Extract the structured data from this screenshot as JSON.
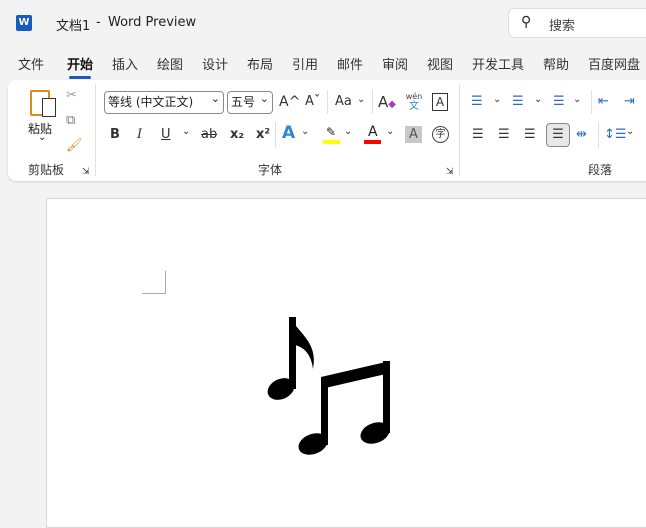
{
  "title": {
    "doc": "文档1",
    "sep": "-",
    "app": "Word Preview",
    "search_placeholder": "搜索"
  },
  "tabs": [
    "文件",
    "开始",
    "插入",
    "绘图",
    "设计",
    "布局",
    "引用",
    "邮件",
    "审阅",
    "视图",
    "开发工具",
    "帮助",
    "百度网盘"
  ],
  "active_tab": 1,
  "clipboard": {
    "paste": "粘贴",
    "group": "剪贴板"
  },
  "font": {
    "name": "等线 (中文正文)",
    "size": "五号",
    "group": "字体",
    "bold": "B",
    "italic": "I",
    "underline": "U",
    "strike": "ab",
    "sub": "x₂",
    "sup": "x²",
    "grow": "A^",
    "shrink": "Aˇ",
    "case": "Aa",
    "phonetic_top": "wén",
    "phonetic": "文",
    "border_char": "A",
    "shade_char": "A",
    "enclose": "字",
    "highlight_color": "#ffff00",
    "font_color": "#ff0000"
  },
  "paragraph": {
    "group": "段落"
  }
}
